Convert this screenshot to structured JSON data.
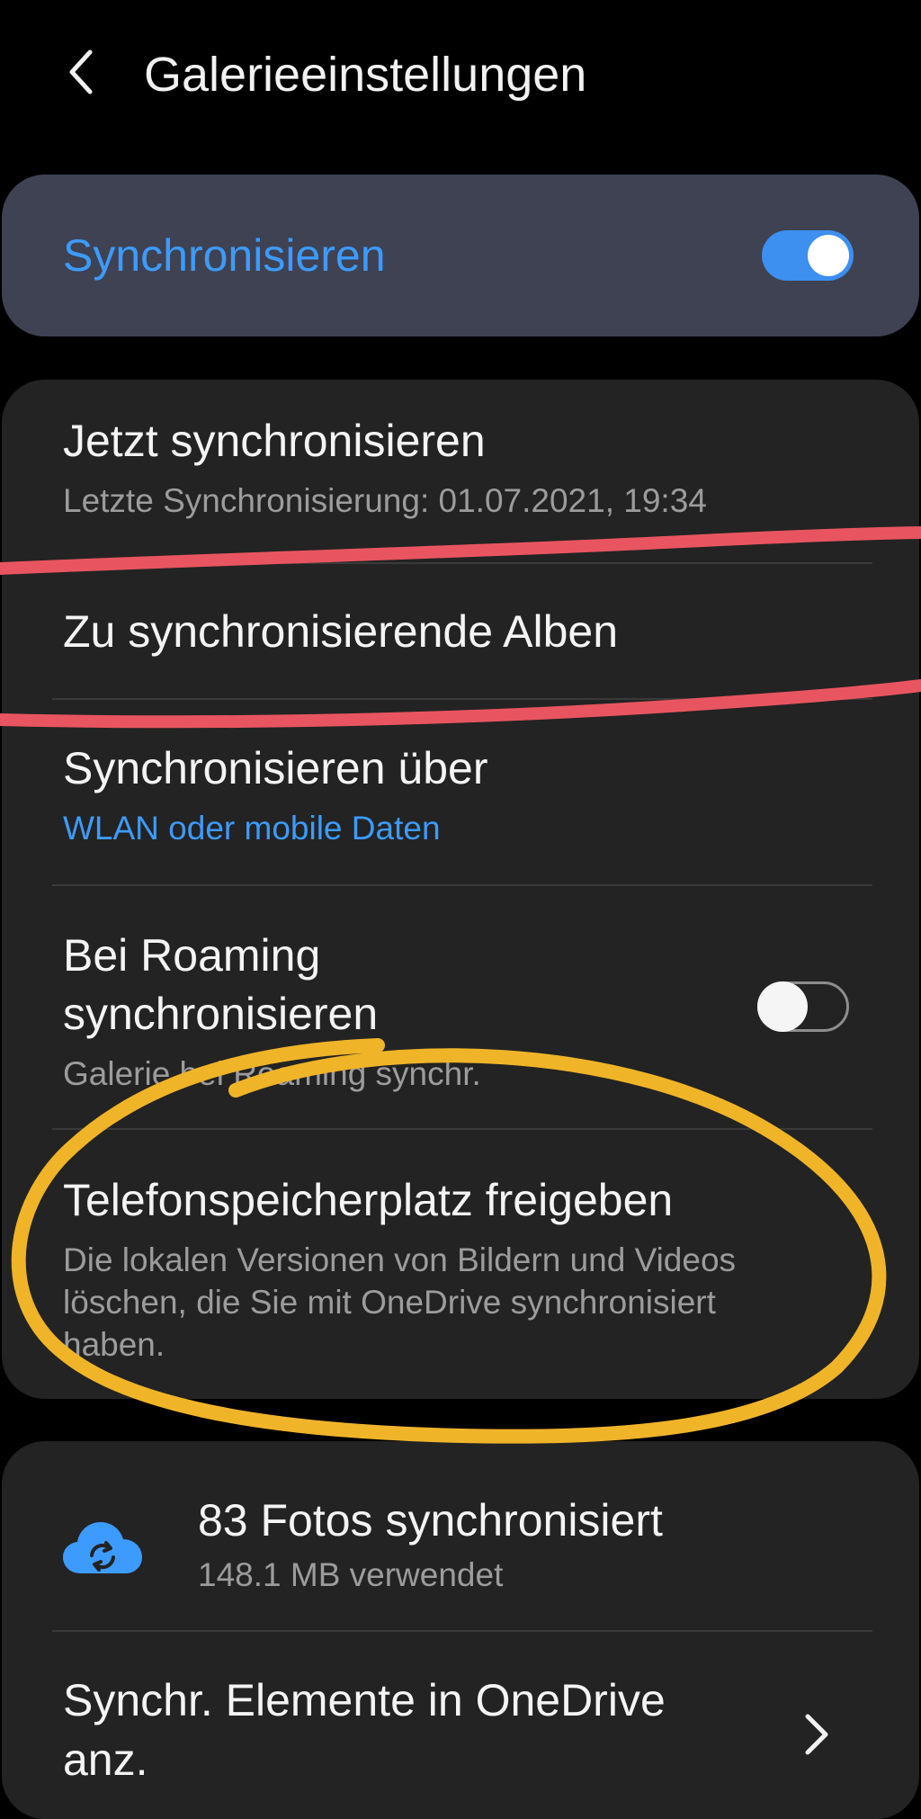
{
  "header": {
    "title": "Galerieeinstellungen"
  },
  "sync": {
    "label": "Synchronisieren",
    "enabled": true
  },
  "settings": {
    "sync_now": {
      "title": "Jetzt synchronisieren",
      "subtitle": "Letzte Synchronisierung: 01.07.2021, 19:34"
    },
    "albums": {
      "title": "Zu synchronisierende Alben"
    },
    "sync_via": {
      "title": "Synchronisieren über",
      "value": "WLAN oder mobile Daten"
    },
    "roaming": {
      "title_line1": "Bei Roaming",
      "title_line2": "synchronisieren",
      "subtitle": "Galerie bei Roaming synchr.",
      "enabled": false
    },
    "free_space": {
      "title": "Telefonspeicherplatz freigeben",
      "subtitle_line1": "Die lokalen Versionen von Bildern und Videos",
      "subtitle_line2": "löschen, die Sie mit OneDrive synchronisiert",
      "subtitle_line3": "haben."
    }
  },
  "storage": {
    "photos_synced": "83 Fotos synchronisiert",
    "used": "148.1 MB verwendet",
    "view_items_line1": "Synchr. Elemente in OneDrive",
    "view_items_line2": "anz."
  },
  "colors": {
    "accent_blue": "#3d9bff",
    "annotation_red": "#e85560",
    "annotation_yellow": "#f0b429"
  }
}
